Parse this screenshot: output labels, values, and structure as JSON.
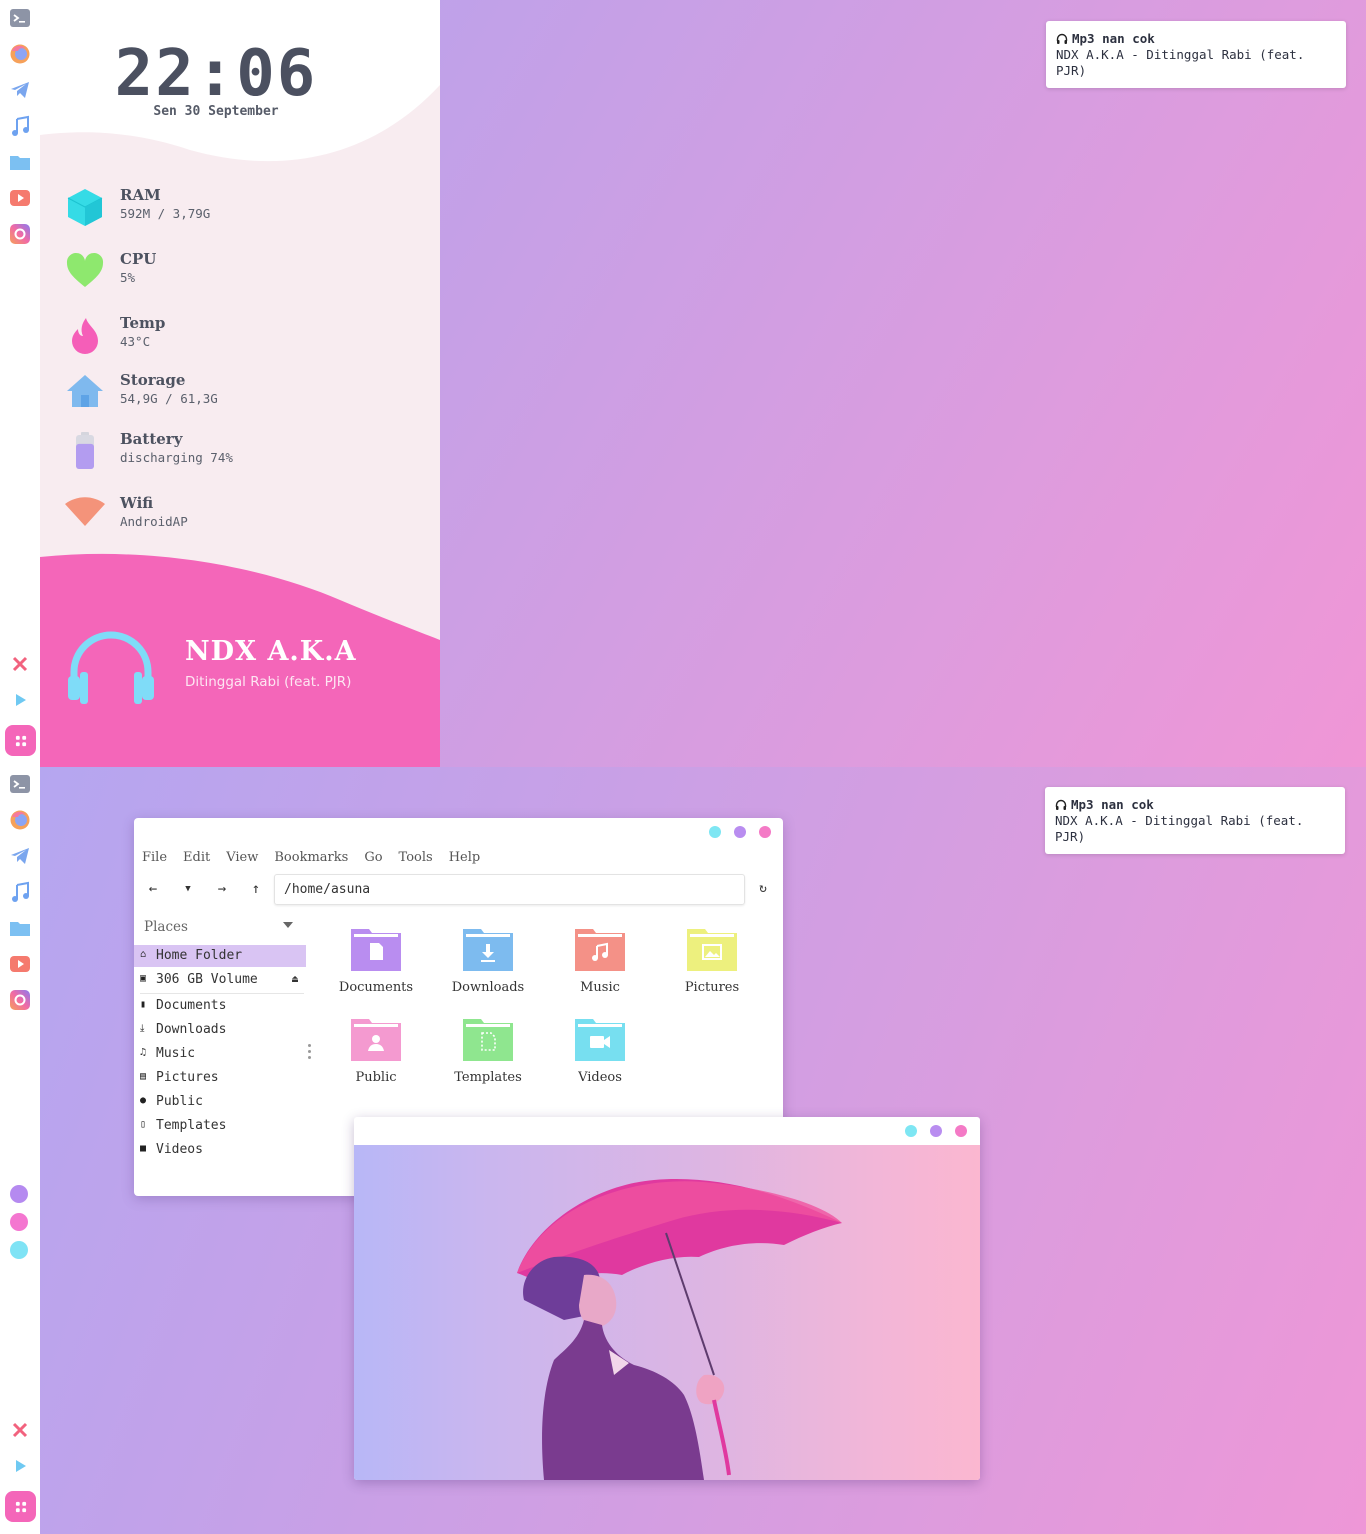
{
  "screen1": {
    "clock": {
      "time": "22:06",
      "date": "Sen 30 September"
    },
    "stats": [
      {
        "icon": "cube-icon",
        "name": "RAM",
        "value": "592M / 3,79G",
        "color": "#35dbe6"
      },
      {
        "icon": "heart-icon",
        "name": "CPU",
        "value": "5%",
        "color": "#8ee86e"
      },
      {
        "icon": "flame-icon",
        "name": "Temp",
        "value": "43°C",
        "color": "#f55eb8"
      },
      {
        "icon": "home-icon",
        "name": "Storage",
        "value": "54,9G / 61,3G",
        "color": "#7fb9ee"
      },
      {
        "icon": "battery-icon",
        "name": "Battery",
        "value": "discharging 74%",
        "level": 0.74,
        "color": "#b39cf0"
      },
      {
        "icon": "wifi-icon",
        "name": "Wifi",
        "value": "AndroidAP",
        "color": "#f4937a"
      }
    ],
    "music": {
      "artist": "NDX A.K.A",
      "title": "Ditinggal Rabi (feat. PJR)"
    },
    "notification": {
      "title": "Mp3 nan cok",
      "body": "NDX A.K.A - Ditinggal Rabi (feat. PJR)"
    }
  },
  "screen2": {
    "notification": {
      "title": "Mp3 nan cok",
      "body": "NDX A.K.A - Ditinggal Rabi (feat. PJR)"
    },
    "file_manager": {
      "menu": [
        "File",
        "Edit",
        "View",
        "Bookmarks",
        "Go",
        "Tools",
        "Help"
      ],
      "path": "/home/asuna",
      "places_label": "Places",
      "devices": [
        {
          "label": "Home Folder",
          "icon": "home-icon",
          "selected": true
        },
        {
          "label": "306 GB Volume",
          "icon": "drive-icon"
        }
      ],
      "bookmarks": [
        {
          "label": "Documents",
          "icon": "document-icon"
        },
        {
          "label": "Downloads",
          "icon": "download-icon"
        },
        {
          "label": "Music",
          "icon": "music-note-icon"
        },
        {
          "label": "Pictures",
          "icon": "picture-icon"
        },
        {
          "label": "Public",
          "icon": "users-icon"
        },
        {
          "label": "Templates",
          "icon": "template-icon"
        },
        {
          "label": "Videos",
          "icon": "video-icon"
        }
      ],
      "folders": [
        {
          "label": "Documents",
          "color": "#b98df0",
          "icon": "document-icon"
        },
        {
          "label": "Downloads",
          "color": "#7dbbef",
          "icon": "download-icon"
        },
        {
          "label": "Music",
          "color": "#f49187",
          "icon": "music-note-icon"
        },
        {
          "label": "Pictures",
          "color": "#edf07e",
          "icon": "picture-icon"
        },
        {
          "label": "Public",
          "color": "#f49ad0",
          "icon": "user-icon"
        },
        {
          "label": "Templates",
          "color": "#8fe68f",
          "icon": "template-icon"
        },
        {
          "label": "Videos",
          "color": "#77dff0",
          "icon": "video-icon"
        }
      ]
    }
  },
  "dock": {
    "icons": [
      "terminal-icon",
      "firefox-icon",
      "telegram-icon",
      "music-icon",
      "folder-icon",
      "youtube-icon",
      "instagram-icon"
    ],
    "bottom": [
      "close-icon",
      "play-icon",
      "apps-grid-icon"
    ],
    "dots": [
      "#b58af0",
      "#f476d0",
      "#7fe3f5"
    ]
  },
  "colors": {
    "pink": "#f466b9",
    "window_cyan": "#7ee6f3",
    "window_purple": "#b98df0",
    "window_pink": "#f47ac6"
  }
}
